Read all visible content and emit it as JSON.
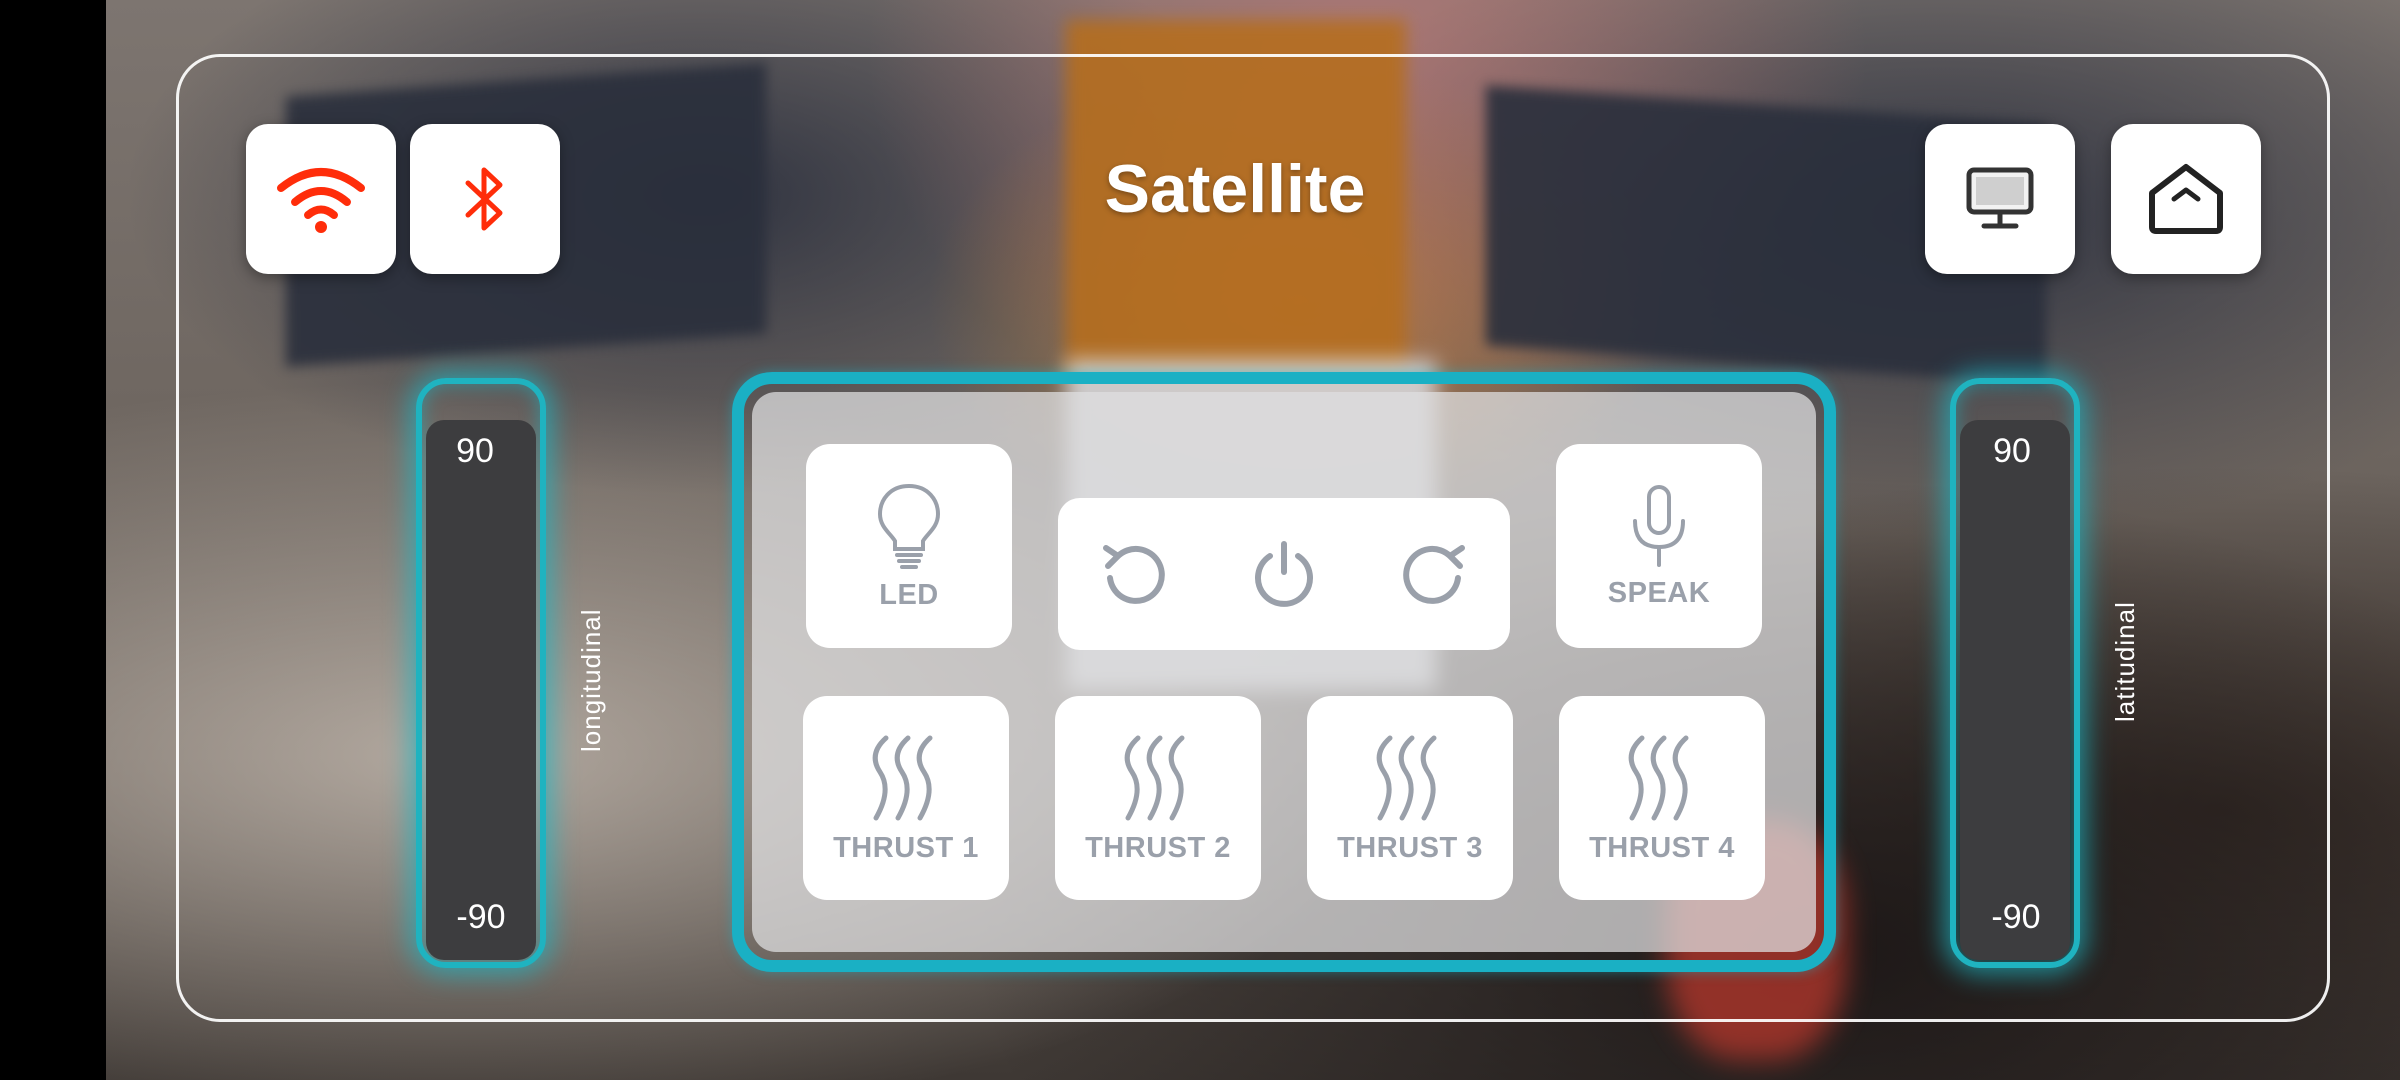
{
  "app": {
    "title": "Satellite"
  },
  "toolbar": {
    "wifi_icon": "wifi-icon",
    "bluetooth_icon": "bluetooth-icon",
    "screen_icon": "monitor-icon",
    "home_icon": "home-icon",
    "active_color": "#ff2d0a",
    "icon_color": "#333333"
  },
  "left_slider": {
    "max": "90",
    "min": "-90",
    "label": "longitudinal"
  },
  "right_slider": {
    "max": "90",
    "min": "-90",
    "label": "latitudinal"
  },
  "controls": {
    "led": {
      "label": "LED",
      "icon": "lightbulb-icon"
    },
    "speak": {
      "label": "SPEAK",
      "icon": "microphone-icon"
    },
    "rotate_left_icon": "rotate-ccw-icon",
    "power_icon": "power-icon",
    "rotate_right_icon": "rotate-cw-icon",
    "thrusters": [
      {
        "label": "THRUST 1",
        "icon": "thrust-icon"
      },
      {
        "label": "THRUST 2",
        "icon": "thrust-icon"
      },
      {
        "label": "THRUST 3",
        "icon": "thrust-icon"
      },
      {
        "label": "THRUST 4",
        "icon": "thrust-icon"
      }
    ],
    "accent_color": "#1ab0c4",
    "label_color": "#9aa0aa"
  }
}
